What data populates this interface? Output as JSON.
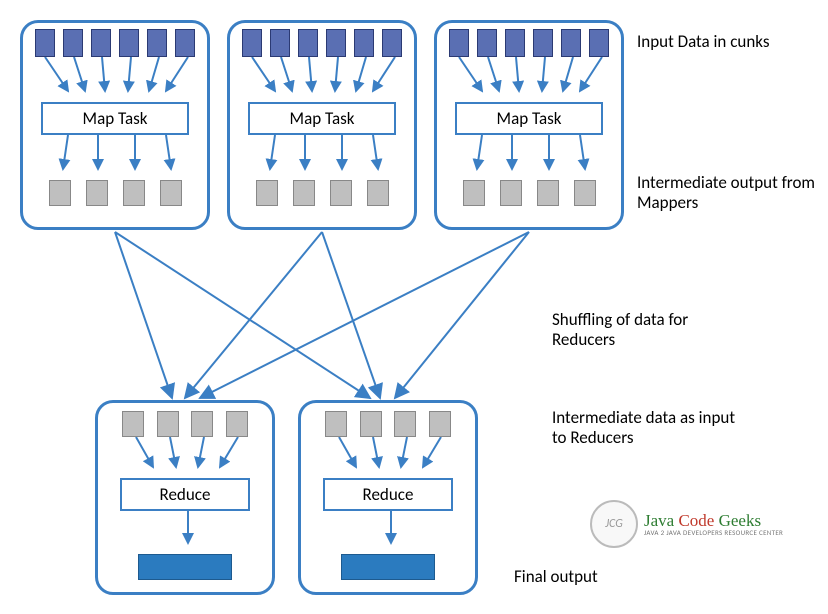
{
  "labels": {
    "input_data": "Input Data in cunks",
    "intermediate_out": "Intermediate output from Mappers",
    "shuffling": "Shuffling of data for Reducers",
    "intermediate_in": "Intermediate data as input to Reducers",
    "final_output": "Final output"
  },
  "mapper": {
    "task_label": "Map Task",
    "count": 3,
    "chunks": 6,
    "intermediates": 4
  },
  "reducer": {
    "task_label": "Reduce",
    "count": 2,
    "inputs": 4
  },
  "logo": {
    "badge": "JCG",
    "brand_java": "Java",
    "brand_code": "Code",
    "brand_geeks": "Geeks",
    "tagline": "JAVA 2 JAVA DEVELOPERS RESOURCE CENTER"
  },
  "colors": {
    "border": "#3b7fc4",
    "chunk": "#5a6fb3",
    "intermediate": "#bfbfbf",
    "output": "#2b7bbf",
    "arrow": "#3b7fc4"
  }
}
